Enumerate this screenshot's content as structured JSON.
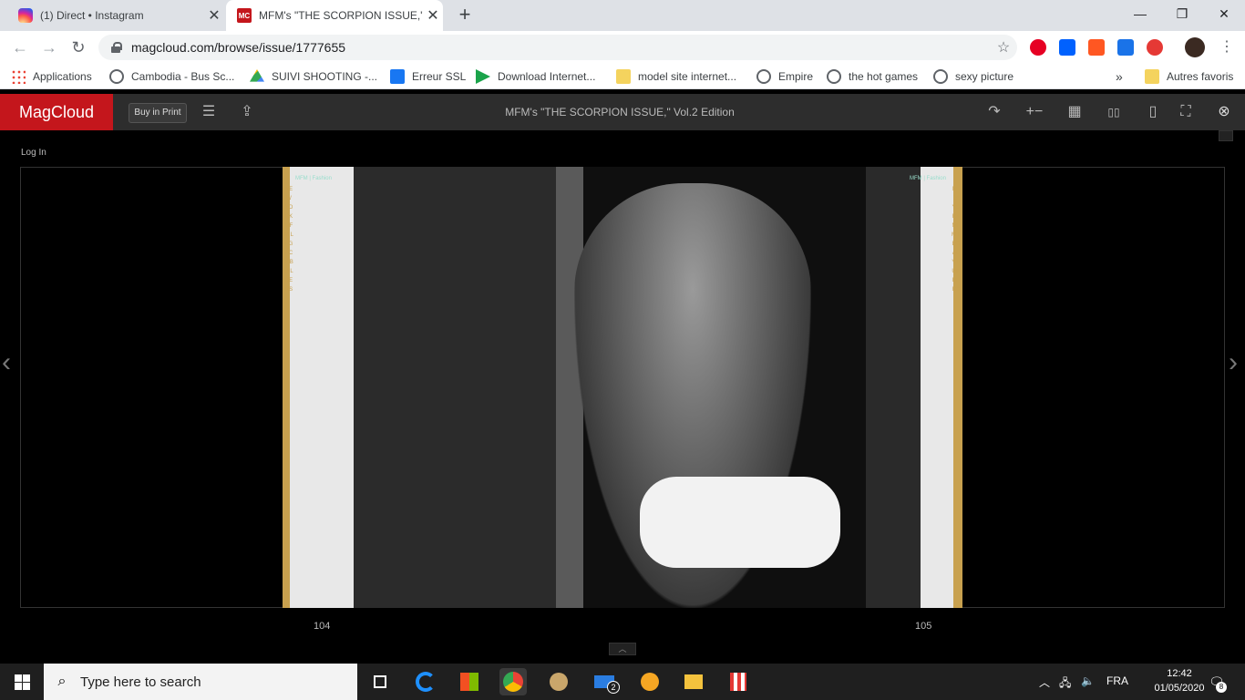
{
  "tabs": [
    {
      "title": "(1) Direct • Instagram",
      "close": "✕"
    },
    {
      "title": "MFM's \"THE SCORPION ISSUE,\" V",
      "icon_text": "MC",
      "close": "✕"
    }
  ],
  "new_tab": "+",
  "window_controls": {
    "minimize": "—",
    "maximize": "❐",
    "close": "✕"
  },
  "nav": {
    "back": "←",
    "forward": "→",
    "reload": "↻"
  },
  "address": {
    "url": "magcloud.com/browse/issue/1777655",
    "star": "☆"
  },
  "bookmarks": [
    {
      "label": "Applications",
      "icon": "apps-icon"
    },
    {
      "label": "Cambodia - Bus Sc...",
      "icon": "globe-icon"
    },
    {
      "label": "SUIVI SHOOTING -...",
      "icon": "drive-icon"
    },
    {
      "label": "Erreur SSL",
      "icon": "facebook-icon"
    },
    {
      "label": "Download Internet...",
      "icon": "play-icon"
    },
    {
      "label": "model site internet...",
      "icon": "folder-icon"
    },
    {
      "label": "Empire",
      "icon": "globe-icon"
    },
    {
      "label": "the hot games",
      "icon": "globe-icon"
    },
    {
      "label": "sexy picture",
      "icon": "globe-icon"
    }
  ],
  "bookmarks_more": "»",
  "other_bookmarks": "Autres favoris",
  "magcloud": {
    "logo": "MagCloud",
    "buy_in_print": "Buy in Print",
    "menu_icon": "☰",
    "share_icon": "⇪",
    "title": "MFM's \"THE SCORPION ISSUE,\" Vol.2 Edition",
    "toolbar_icons": {
      "rotate": "↷",
      "zoom": "+−",
      "grid": "▦",
      "spread": "▯▯",
      "page": "▯",
      "fullscreen": "⛶",
      "close": "⊗"
    },
    "login": "Log In",
    "prev": "‹",
    "next": "›",
    "page_left": "104",
    "page_right": "105",
    "collapse": "︿",
    "spread_left_vertical": "NEW YORK MFM LEGACY BUILDERS",
    "spread_right_vertical": "NEW YORK MFM LEGACY BUILDERS",
    "spread_left_header": "MFM | Fashion",
    "spread_right_header": "MFM | Fashion"
  },
  "taskbar": {
    "search_placeholder": "Type here to search",
    "mail_badge": "2",
    "language": "FRA",
    "time": "12:42",
    "date": "01/05/2020",
    "notifications": "8"
  }
}
